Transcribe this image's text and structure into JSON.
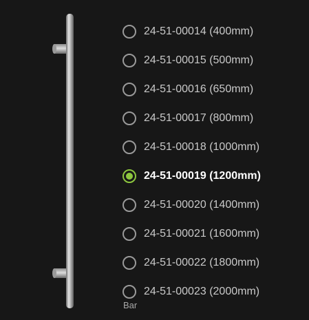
{
  "options": [
    {
      "label": "24-51-00014 (400mm)",
      "selected": false
    },
    {
      "label": "24-51-00015 (500mm)",
      "selected": false
    },
    {
      "label": "24-51-00016 (650mm)",
      "selected": false
    },
    {
      "label": "24-51-00017 (800mm)",
      "selected": false
    },
    {
      "label": "24-51-00018 (1000mm)",
      "selected": false
    },
    {
      "label": "24-51-00019 (1200mm)",
      "selected": true
    },
    {
      "label": "24-51-00020 (1400mm)",
      "selected": false
    },
    {
      "label": "24-51-00021 (1600mm)",
      "selected": false
    },
    {
      "label": "24-51-00022 (1800mm)",
      "selected": false
    },
    {
      "label": "24-51-00023 (2000mm)",
      "selected": false
    }
  ],
  "caption": "Bar",
  "colors": {
    "background": "#171717",
    "accent": "#8dc63f",
    "text": "#c9c9c9",
    "text_selected": "#ffffff"
  }
}
